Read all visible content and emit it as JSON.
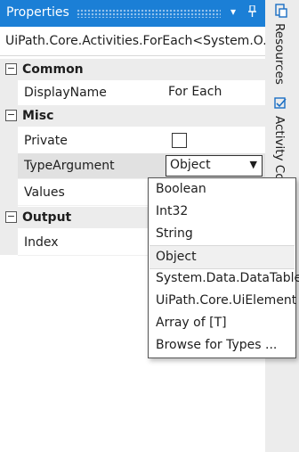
{
  "panel": {
    "title": "Properties",
    "subtitle": "UiPath.Core.Activities.ForEach<System.O..."
  },
  "categories": [
    {
      "label": "Common",
      "expander": "−"
    },
    {
      "label": "Misc",
      "expander": "−"
    },
    {
      "label": "Output",
      "expander": "−"
    }
  ],
  "properties": {
    "display_name": {
      "name": "DisplayName",
      "value": "For Each"
    },
    "private": {
      "name": "Private",
      "checked": false
    },
    "type_argument": {
      "name": "TypeArgument",
      "value": "Object"
    },
    "values": {
      "name": "Values"
    },
    "index": {
      "name": "Index"
    }
  },
  "dropdown": {
    "options": [
      "Boolean",
      "Int32",
      "String",
      "Object",
      "System.Data.DataTable",
      "UiPath.Core.UiElement",
      "Array of [T]",
      "Browse for Types ..."
    ],
    "selected": "Object"
  },
  "dock_tabs": [
    {
      "label": "Resources",
      "icon": "resources-icon"
    },
    {
      "label": "Activity Co",
      "icon": "activity-icon"
    }
  ],
  "icons": {
    "dropdown_arrow": "▼",
    "pin": "📌",
    "collapse": "▾"
  },
  "colors": {
    "titlebar": "#1b7fd6",
    "accent": "#1b6fc4"
  }
}
